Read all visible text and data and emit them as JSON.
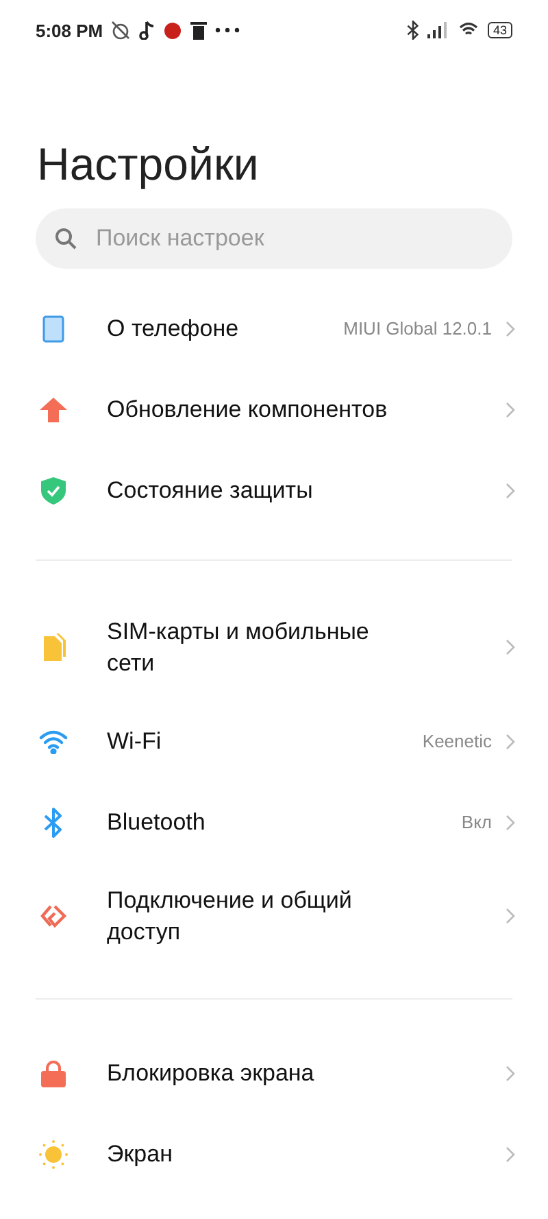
{
  "status_bar": {
    "time": "5:08 PM",
    "battery": "43"
  },
  "title": "Настройки",
  "search": {
    "placeholder": "Поиск настроек"
  },
  "groups": [
    {
      "items": [
        {
          "kind": "phone",
          "label": "О телефоне",
          "value": "MIUI Global 12.0.1"
        },
        {
          "kind": "update",
          "label": "Обновление компонентов"
        },
        {
          "kind": "shield",
          "label": "Состояние защиты"
        }
      ]
    },
    {
      "items": [
        {
          "kind": "sim",
          "label": "SIM-карты и мобильные сети"
        },
        {
          "kind": "wifi",
          "label": "Wi-Fi",
          "value": "Keenetic"
        },
        {
          "kind": "bluetooth",
          "label": "Bluetooth",
          "value": "Вкл"
        },
        {
          "kind": "share",
          "label": "Подключение и общий доступ"
        }
      ]
    },
    {
      "items": [
        {
          "kind": "lock",
          "label": "Блокировка экрана"
        },
        {
          "kind": "sun",
          "label": "Экран"
        }
      ]
    }
  ]
}
